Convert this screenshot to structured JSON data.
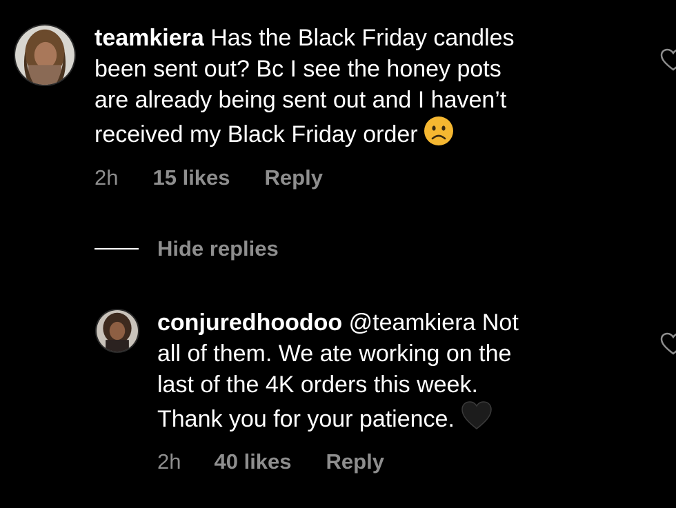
{
  "comments": [
    {
      "username": "teamkiera",
      "text": " Has the Black Friday candles\nbeen sent out? Bc I see the honey pots\nare already being sent out and I haven’t\nreceived my Black Friday order",
      "emoji": "frowning-face-icon",
      "time": "2h",
      "likes": "15 likes",
      "reply_label": "Reply"
    }
  ],
  "hide_replies_label": "Hide replies",
  "replies": [
    {
      "username": "conjuredhoodoo",
      "text": " @teamkiera Not\nall of them. We ate working on the\nlast of the 4K orders this week.\nThank you for your patience.",
      "emoji": "black-heart-icon",
      "time": "2h",
      "likes": "40 likes",
      "reply_label": "Reply"
    }
  ],
  "colors": {
    "background": "#000000",
    "text_primary": "#ffffff",
    "text_secondary": "#8e8e8e",
    "emoji_face": "#f5b731"
  }
}
